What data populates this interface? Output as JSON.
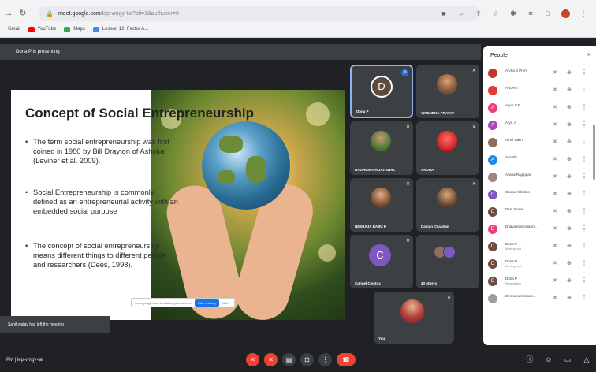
{
  "browser": {
    "url_host": "meet.google.com",
    "url_path": "/lep-vmgy-tat?pli=1&authuser=0",
    "bookmarks": [
      {
        "label": "Gmail",
        "color": "#ea4335"
      },
      {
        "label": "YouTube",
        "color": "#ff0000"
      },
      {
        "label": "Maps",
        "color": "#34a853"
      },
      {
        "label": "Lesson 12: Factor A...",
        "color": "#4285f4"
      }
    ]
  },
  "presentation": {
    "banner": "Dona P is presenting",
    "slide": {
      "title": "Concept of Social Entrepreneurship",
      "bullets": [
        "The term social entrepreneurship was first coined in 1980 by Bill Drayton of Ashoka (Leviner et al. 2009).",
        "Social Entrepreneurship is commonly defined as an entrepreneurial activity with an embedded social purpose",
        "The concept of social entrepreneurship means different things to different people and researchers (Dees, 1998)."
      ]
    },
    "share_bar": {
      "text": "meet.google.com is sharing your screen.",
      "stop_label": "Stop sharing",
      "hide_label": "Hide"
    }
  },
  "tiles": [
    {
      "name": "Dona P",
      "initial": "D",
      "color": "#5f4b3e"
    },
    {
      "name": "VIRENDRA PRATAP"
    },
    {
      "name": "RAGHUNATH JAYSWAL"
    },
    {
      "name": "ARDRA"
    },
    {
      "name": "NEERAJA BABU K"
    },
    {
      "name": "Daman Chauhan"
    },
    {
      "name": "Carmel Clestus",
      "initial": "C",
      "color": "#7e57c2"
    },
    {
      "name": "43 others"
    },
    {
      "name": "You"
    }
  ],
  "toast": "Sahil yadav has left the meeting",
  "bottom": {
    "time_code": "PM | lep-vmgy-tat"
  },
  "people": {
    "title": "People",
    "close": "×",
    "list": [
      {
        "name": "Archa S Prem",
        "initial": "",
        "color": "#c0392b",
        "sub": ""
      },
      {
        "name": "ARDRA",
        "initial": "",
        "color": "#e53935",
        "sub": ""
      },
      {
        "name": "Arjun V R",
        "initial": "A",
        "color": "#ec407a",
        "sub": ""
      },
      {
        "name": "Arya Jr",
        "initial": "A",
        "color": "#ab47bc",
        "sub": ""
      },
      {
        "name": "Athul Nalin",
        "initial": "",
        "color": "#8d6e63",
        "sub": ""
      },
      {
        "name": "Avanthi",
        "initial": "A",
        "color": "#1e88e5",
        "sub": ""
      },
      {
        "name": "Ayana Rajappan",
        "initial": "",
        "color": "#a1887f",
        "sub": ""
      },
      {
        "name": "Carmel Clestus",
        "initial": "C",
        "color": "#7e57c2",
        "sub": ""
      },
      {
        "name": "Dan James",
        "initial": "D",
        "color": "#6d4c41",
        "sub": ""
      },
      {
        "name": "Dhava Krishnakum...",
        "initial": "D",
        "color": "#ec407a",
        "sub": ""
      },
      {
        "name": "Dona P",
        "initial": "D",
        "color": "#6d4c41",
        "sub": "Meeting host"
      },
      {
        "name": "Dona P",
        "initial": "D",
        "color": "#6d4c41",
        "sub": "Meeting host"
      },
      {
        "name": "Dona P",
        "initial": "D",
        "color": "#6d4c41",
        "sub": "Presentation"
      },
      {
        "name": "Emmanuel Josep...",
        "initial": "",
        "color": "#9e9e9e",
        "sub": ""
      }
    ]
  }
}
